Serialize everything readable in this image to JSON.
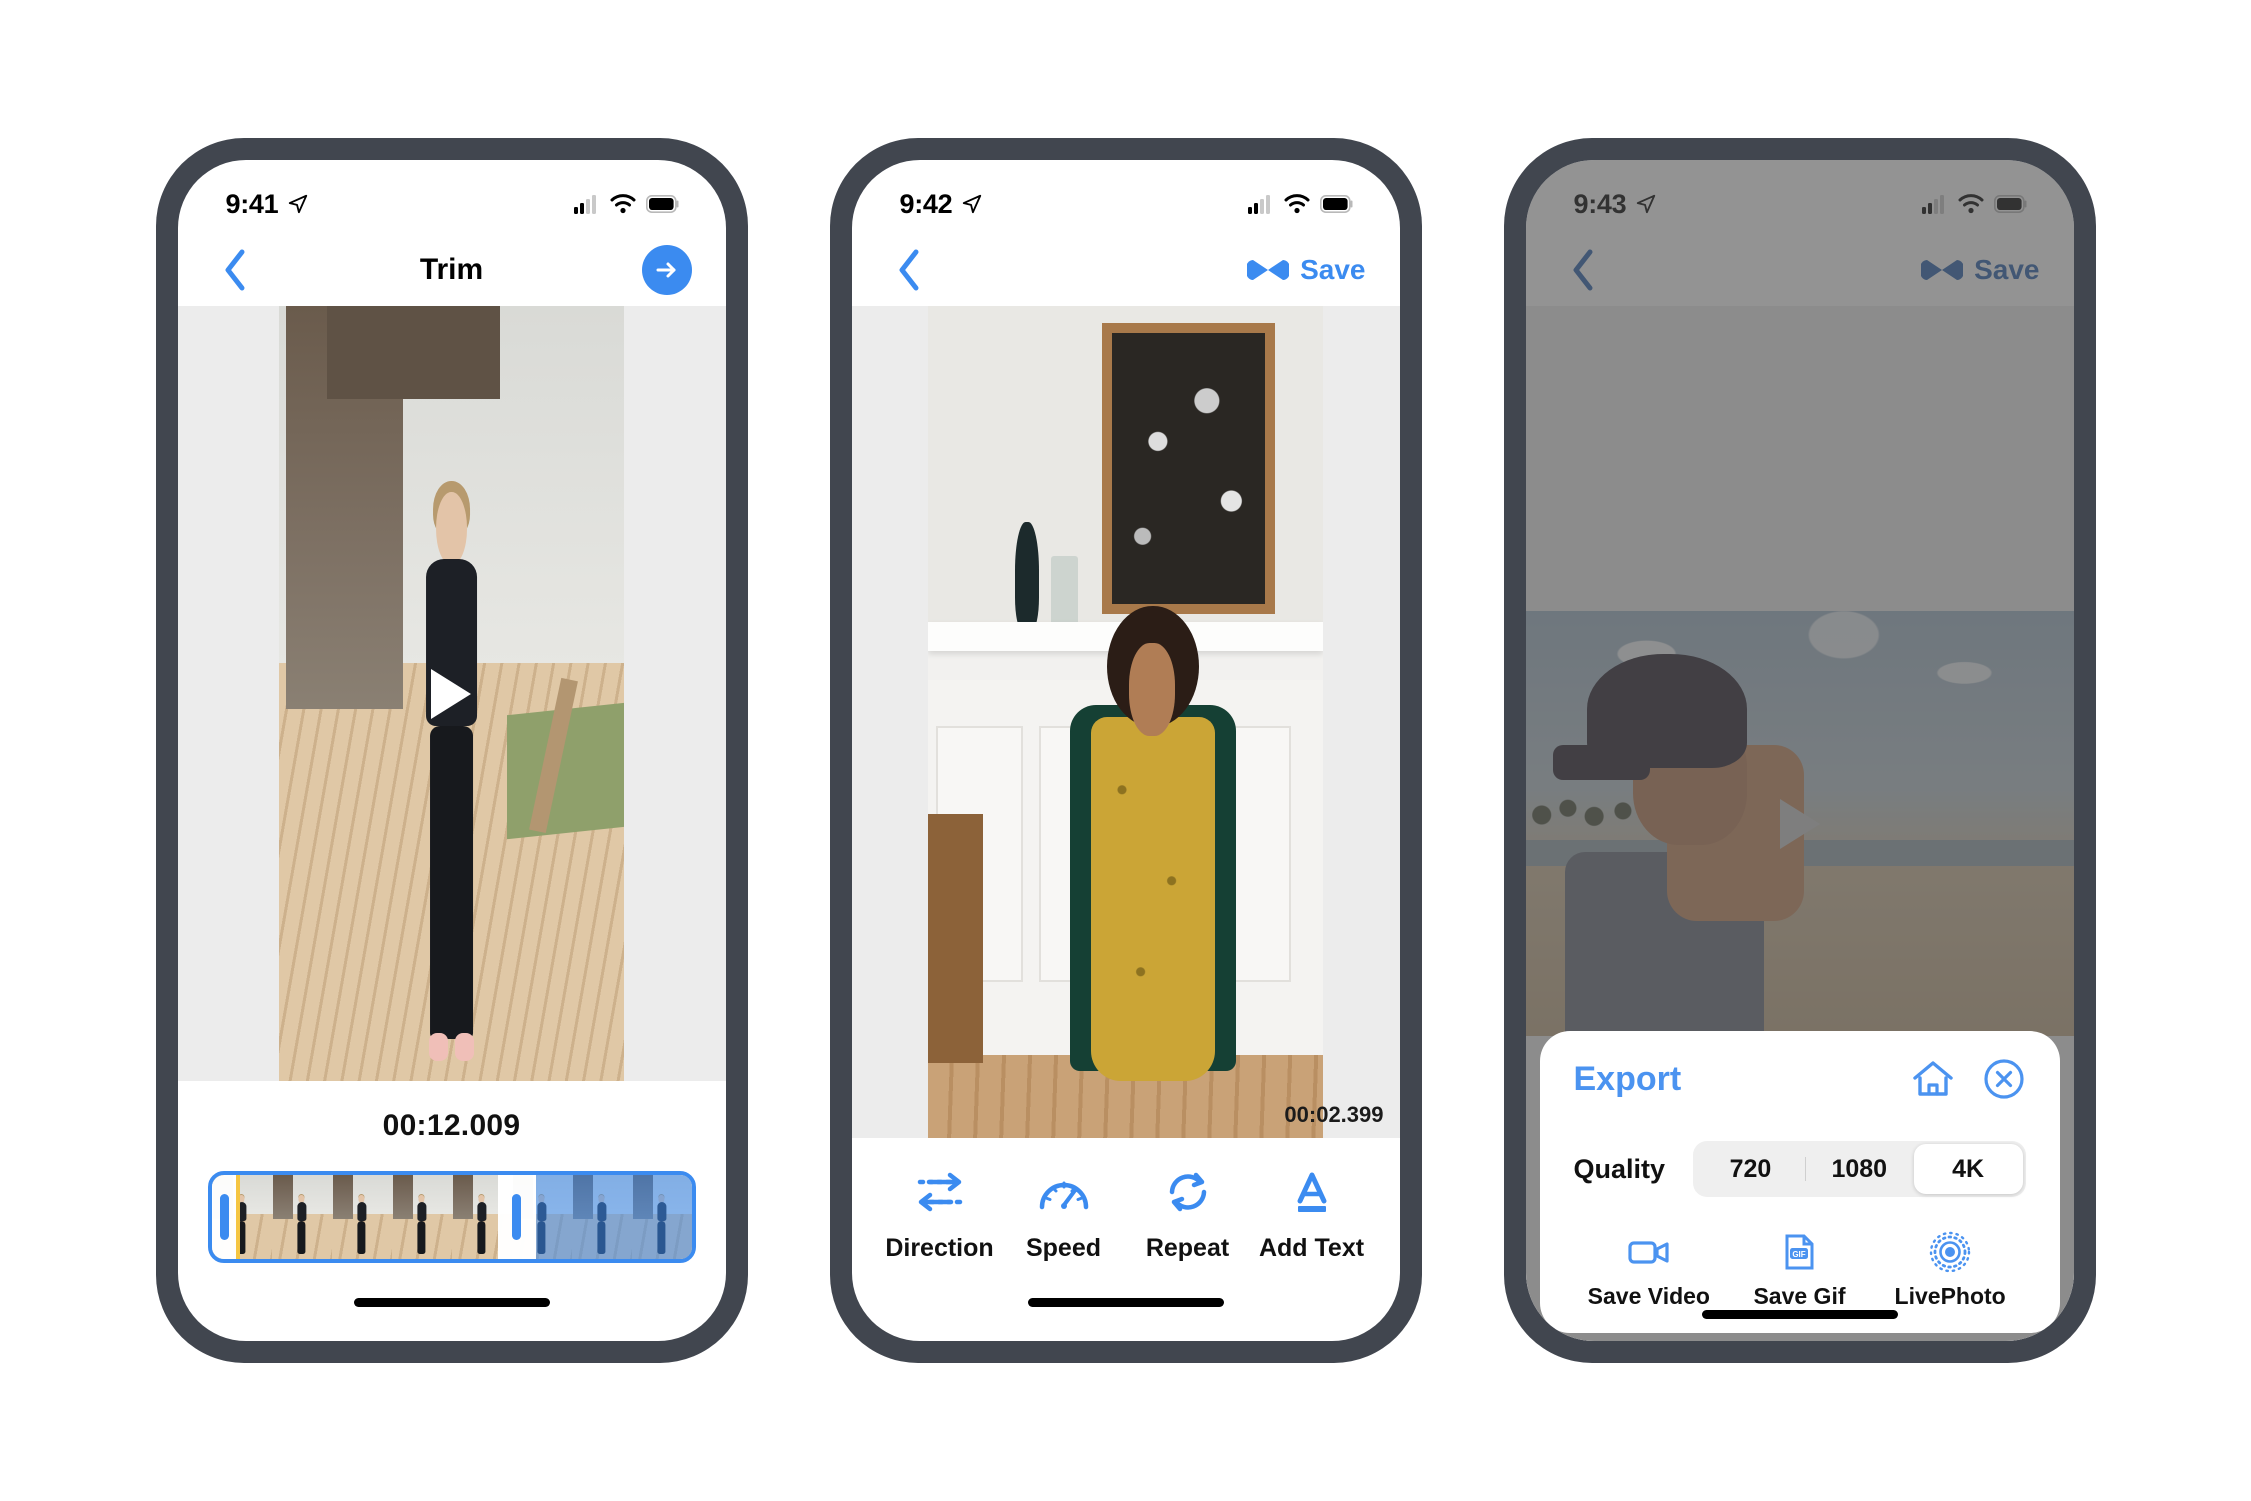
{
  "app": {
    "accent": "#3b8bf0",
    "frame_color": "#41464f"
  },
  "phones": [
    {
      "id": "trim-screen",
      "status": {
        "time": "9:41",
        "location_icon": "location-arrow-icon",
        "signal_icon": "cellular-signal-icon",
        "wifi_icon": "wifi-icon",
        "battery_icon": "battery-icon"
      },
      "nav": {
        "back_icon": "chevron-left-icon",
        "title": "Trim",
        "next_icon": "arrow-right-icon"
      },
      "preview": {
        "play_icon": "play-triangle-icon"
      },
      "trim": {
        "duration": "00:12.009",
        "handle_left": "trim-handle-left",
        "handle_right": "trim-handle-right",
        "playhead": "playhead-marker"
      }
    },
    {
      "id": "edit-screen",
      "status": {
        "time": "9:42",
        "location_icon": "location-arrow-icon",
        "signal_icon": "cellular-signal-icon",
        "wifi_icon": "wifi-icon",
        "battery_icon": "battery-icon"
      },
      "nav": {
        "back_icon": "chevron-left-icon",
        "save_icon": "loop-bowtie-icon",
        "save_label": "Save"
      },
      "preview": {
        "timestamp": "00:02.399"
      },
      "tools": [
        {
          "label": "Direction",
          "icon": "two-way-arrows-icon"
        },
        {
          "label": "Speed",
          "icon": "speedometer-icon"
        },
        {
          "label": "Repeat",
          "icon": "refresh-loop-icon"
        },
        {
          "label": "Add Text",
          "icon": "text-a-icon"
        }
      ]
    },
    {
      "id": "export-screen",
      "status": {
        "time": "9:43",
        "location_icon": "location-arrow-icon",
        "signal_icon": "cellular-signal-icon",
        "wifi_icon": "wifi-icon",
        "battery_icon": "battery-icon"
      },
      "nav": {
        "back_icon": "chevron-left-icon",
        "save_icon": "loop-bowtie-icon",
        "save_label": "Save"
      },
      "preview": {
        "play_icon": "play-triangle-icon"
      },
      "export": {
        "title": "Export",
        "home_icon": "home-icon",
        "close_icon": "close-circle-icon",
        "quality_label": "Quality",
        "quality_options": [
          {
            "label": "720",
            "selected": false
          },
          {
            "label": "1080",
            "selected": false
          },
          {
            "label": "4K",
            "selected": true
          }
        ],
        "actions": [
          {
            "label": "Save Video",
            "icon": "video-camera-icon"
          },
          {
            "label": "Save Gif",
            "icon": "gif-file-icon"
          },
          {
            "label": "LivePhoto",
            "icon": "livephoto-icon"
          }
        ]
      }
    }
  ]
}
